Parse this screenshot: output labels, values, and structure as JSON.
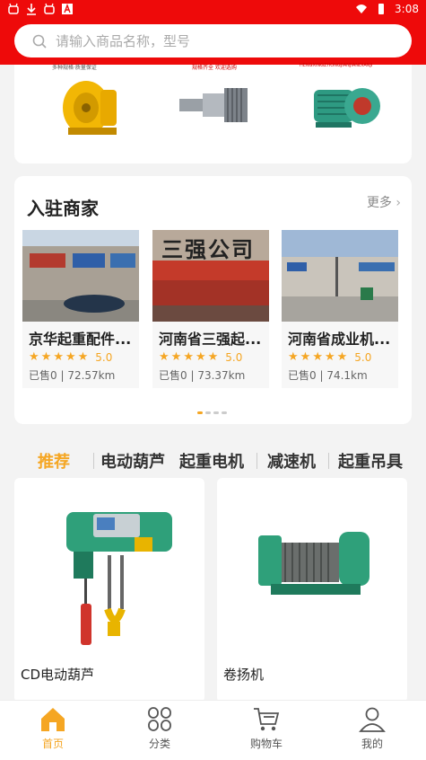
{
  "status_bar": {
    "time": "3:08",
    "left_icons": [
      "bug-icon",
      "download-icon",
      "bug-icon",
      "font-icon"
    ],
    "right_icons": [
      "wifi-icon",
      "battery-icon"
    ]
  },
  "search": {
    "placeholder": "请输入商品名称，型号"
  },
  "featured_products": [
    {
      "caption": "多种规格·质量保证",
      "icon": "yellow-drum-product"
    },
    {
      "caption": "规格齐全 欢迎选购",
      "icon": "shaft-product"
    },
    {
      "caption": "HENGXINGZHONGJIANJIANDIANJI",
      "icon": "motor-product"
    }
  ],
  "merchants_section": {
    "title": "入驻商家",
    "more_label": "更多",
    "items": [
      {
        "name": "京华起重配件...",
        "rating": "5.0",
        "sold": "已售0",
        "distance": "72.57km"
      },
      {
        "name": "河南省三强起...",
        "rating": "5.0",
        "sold": "已售0",
        "distance": "73.37km"
      },
      {
        "name": "河南省成业机...",
        "rating": "5.0",
        "sold": "已售0",
        "distance": "74.1km"
      }
    ],
    "sign_text": "三强公司"
  },
  "category_tabs": [
    {
      "label": "推荐",
      "active": true
    },
    {
      "label": "电动葫芦",
      "active": false
    },
    {
      "label": "起重电机",
      "active": false
    },
    {
      "label": "减速机",
      "active": false
    },
    {
      "label": "起重吊具",
      "active": false
    }
  ],
  "products": [
    {
      "name": "CD电动葫芦"
    },
    {
      "name": "卷扬机"
    }
  ],
  "bottom_nav": [
    {
      "label": "首页",
      "icon": "home-icon",
      "active": true
    },
    {
      "label": "分类",
      "icon": "category-icon",
      "active": false
    },
    {
      "label": "购物车",
      "icon": "cart-icon",
      "active": false
    },
    {
      "label": "我的",
      "icon": "user-icon",
      "active": false
    }
  ],
  "colors": {
    "header": "#ee0a0a",
    "accent": "#f5a623"
  }
}
